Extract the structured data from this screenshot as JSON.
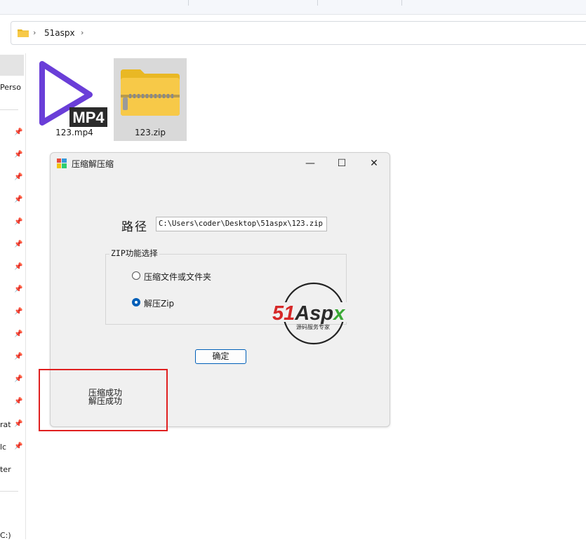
{
  "explorer": {
    "breadcrumb": "51aspx",
    "nav_labels": [
      "Perso",
      "rat",
      "lc",
      "ter",
      "C:)"
    ],
    "files": [
      {
        "name": "123.mp4",
        "icon": "mp4-video-icon",
        "badge": "MP4"
      },
      {
        "name": "123.zip",
        "icon": "zip-folder-icon"
      }
    ]
  },
  "dialog": {
    "title": "压缩解压缩",
    "path_label": "路径",
    "path_value": "C:\\Users\\coder\\Desktop\\51aspx\\123.zip",
    "group_label": "ZIP功能选择",
    "options": [
      {
        "label": "压缩文件或文件夹",
        "checked": false
      },
      {
        "label": "解压Zip",
        "checked": true
      }
    ],
    "ok_label": "确定",
    "status_lines": [
      "压缩成功",
      "解压成功"
    ]
  },
  "watermark": {
    "brand": "51Aspx",
    "tagline": "源码服务专家"
  },
  "colors": {
    "accent": "#005fb8",
    "highlight_box": "#e02020",
    "mp4_purple": "#6a3ed8",
    "folder_yellow": "#f7c948"
  }
}
